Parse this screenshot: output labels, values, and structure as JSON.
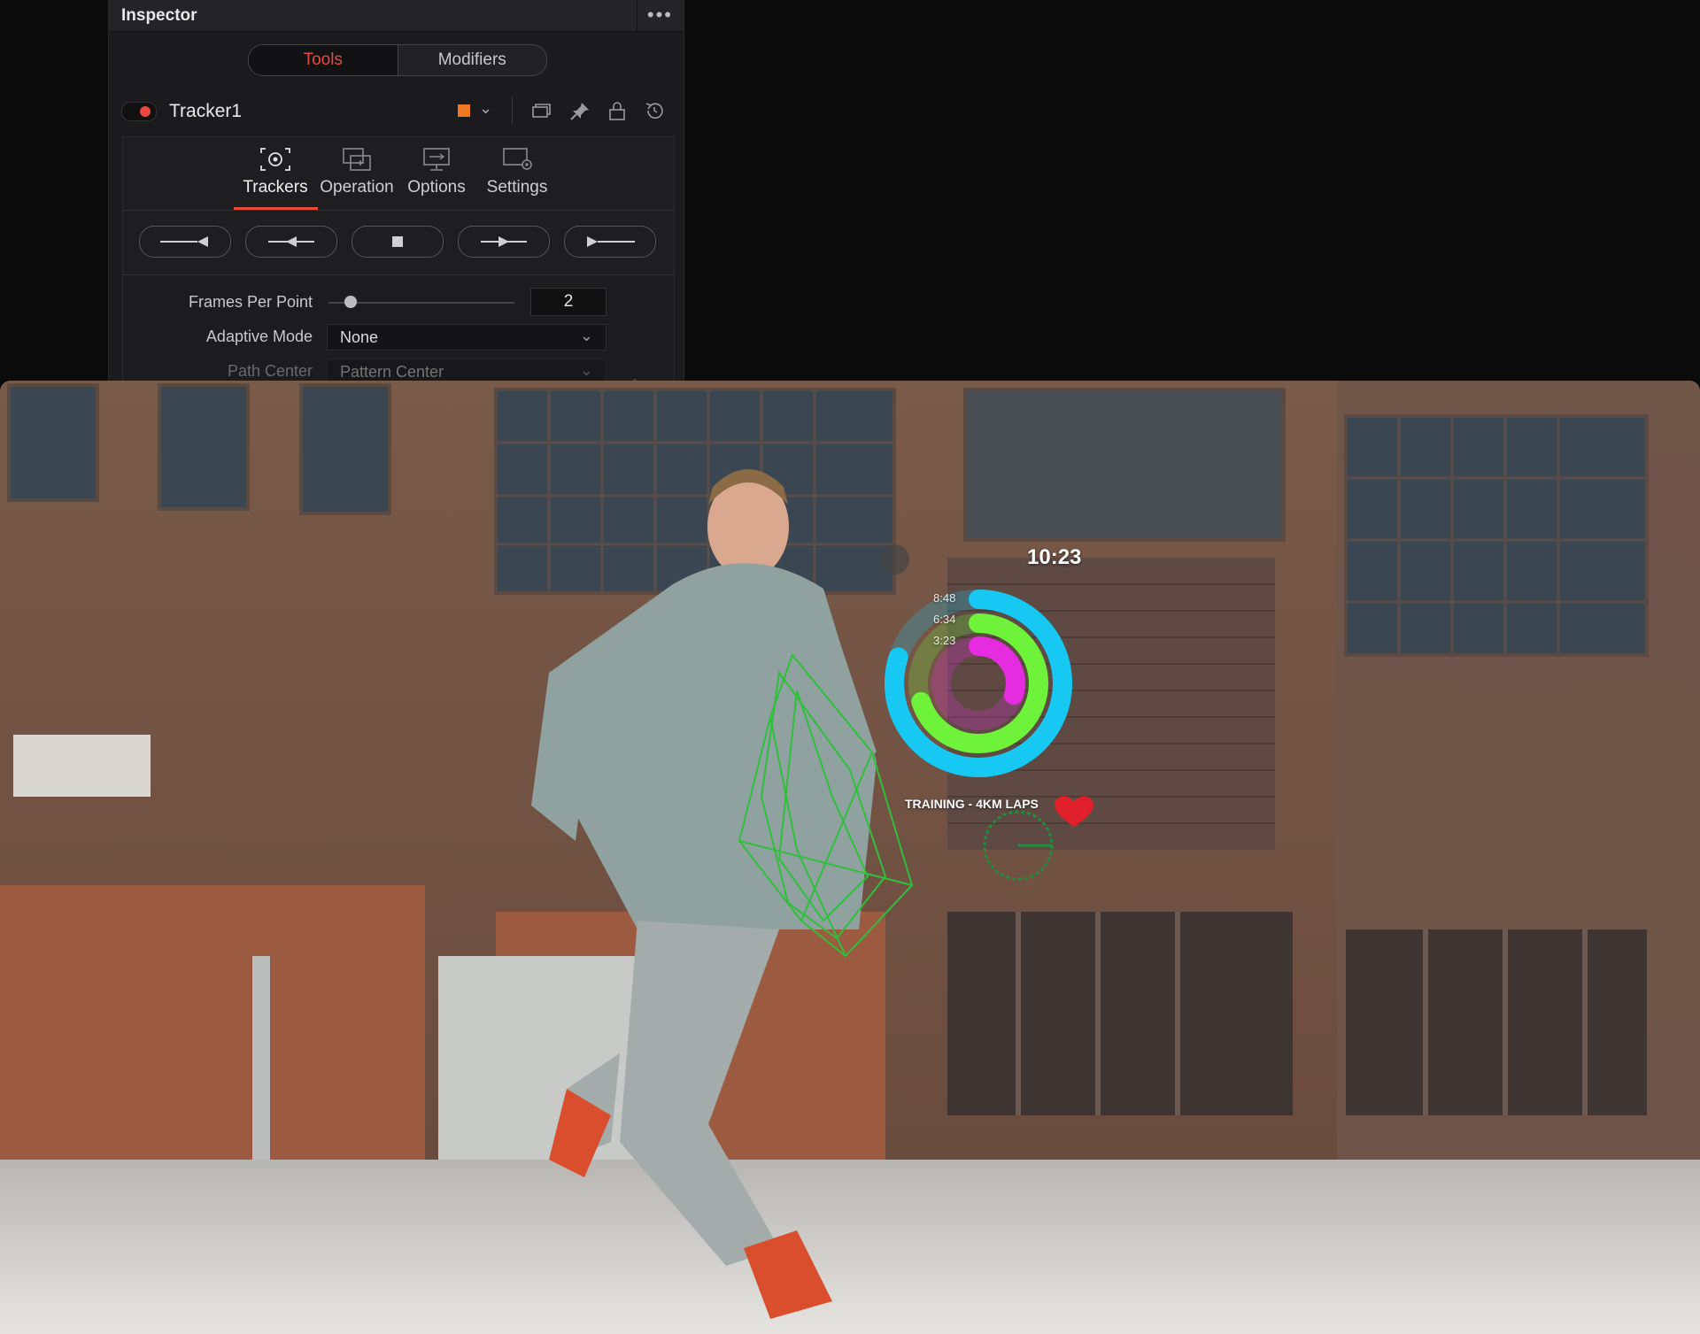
{
  "inspector": {
    "title": "Inspector",
    "menu_label": "•••",
    "segment": {
      "tools": "Tools",
      "modifiers": "Modifiers",
      "active": "Tools"
    },
    "node": {
      "name": "Tracker1",
      "enabled": true,
      "color": "#f07822"
    },
    "tabs": [
      {
        "label": "Trackers",
        "icon": "tracker-target-icon",
        "active": true
      },
      {
        "label": "Operation",
        "icon": "operation-icon",
        "active": false
      },
      {
        "label": "Options",
        "icon": "options-monitor-icon",
        "active": false
      },
      {
        "label": "Settings",
        "icon": "settings-gear-icon",
        "active": false
      }
    ],
    "transport": [
      "track-reverse-from-end",
      "track-reverse",
      "stop",
      "track-forward",
      "track-forward-from-start"
    ],
    "params": {
      "frames_per_point": {
        "label": "Frames Per Point",
        "value": "2"
      },
      "adaptive_mode": {
        "label": "Adaptive Mode",
        "value": "None"
      },
      "path_center": {
        "label": "Path Center",
        "value": "Pattern Center"
      }
    }
  },
  "overlay": {
    "time": "10:23",
    "rings": [
      {
        "label": "8:48",
        "color": "#17c9f2",
        "progress": 0.8
      },
      {
        "label": "6:34",
        "color": "#6ef23a",
        "progress": 0.7
      },
      {
        "label": "3:23",
        "color": "#e62ce0",
        "progress": 0.3
      }
    ],
    "caption": "TRAINING - 4KM LAPS",
    "heart_color": "#e0202a"
  }
}
